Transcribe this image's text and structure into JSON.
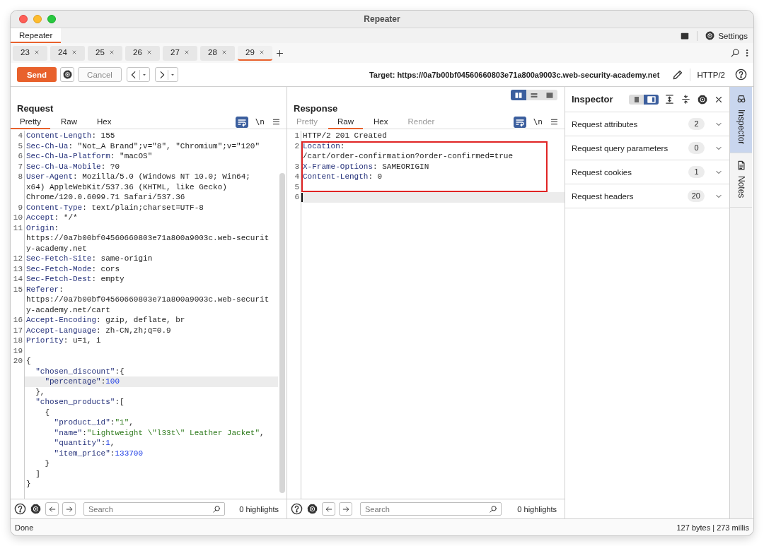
{
  "window": {
    "title": "Repeater"
  },
  "tool_tabs": [
    {
      "label": "Repeater",
      "selected": true
    }
  ],
  "settings_button": "Settings",
  "repeater_tabs": [
    {
      "label": "23",
      "selected": false
    },
    {
      "label": "24",
      "selected": false
    },
    {
      "label": "25",
      "selected": false
    },
    {
      "label": "26",
      "selected": false
    },
    {
      "label": "27",
      "selected": false
    },
    {
      "label": "28",
      "selected": false
    },
    {
      "label": "29",
      "selected": true
    }
  ],
  "toolbar": {
    "send": "Send",
    "cancel": "Cancel",
    "cancel_disabled": true,
    "target": "Target: https://0a7b00bf04560660803e71a800a9003c.web-security-academy.net",
    "protocol": "HTTP/2"
  },
  "request": {
    "title": "Request",
    "view_tabs": [
      {
        "label": "Pretty",
        "selected": true,
        "disabled": false
      },
      {
        "label": "Raw",
        "selected": false,
        "disabled": false
      },
      {
        "label": "Hex",
        "selected": false,
        "disabled": false
      }
    ],
    "wrap_on": true,
    "newline_toggle": "\\n",
    "lines": [
      {
        "number": "4",
        "parts": [
          {
            "kind": "key",
            "text": "Content-Length"
          },
          {
            "kind": "plain",
            "text": ": 155"
          }
        ],
        "highlighted": false
      },
      {
        "number": "5",
        "parts": [
          {
            "kind": "key",
            "text": "Sec-Ch-Ua"
          },
          {
            "kind": "plain",
            "text": ": \"Not_A Brand\";v=\"8\", \"Chromium\";v=\"120\""
          }
        ],
        "highlighted": false
      },
      {
        "number": "6",
        "parts": [
          {
            "kind": "key",
            "text": "Sec-Ch-Ua-Platform"
          },
          {
            "kind": "plain",
            "text": ": \"macOS\""
          }
        ],
        "highlighted": false
      },
      {
        "number": "7",
        "parts": [
          {
            "kind": "key",
            "text": "Sec-Ch-Ua-Mobile"
          },
          {
            "kind": "plain",
            "text": ": ?0"
          }
        ],
        "highlighted": false
      },
      {
        "number": "8",
        "parts": [
          {
            "kind": "key",
            "text": "User-Agent"
          },
          {
            "kind": "plain",
            "text": ": Mozilla/5.0 (Windows NT 10.0; Win64;"
          }
        ],
        "highlighted": false
      },
      {
        "parts": [
          {
            "kind": "plain",
            "text": "x64) AppleWebKit/537.36 (KHTML, like Gecko)"
          }
        ],
        "highlighted": false
      },
      {
        "parts": [
          {
            "kind": "plain",
            "text": "Chrome/120.0.6099.71 Safari/537.36"
          }
        ],
        "highlighted": false
      },
      {
        "number": "9",
        "parts": [
          {
            "kind": "key",
            "text": "Content-Type"
          },
          {
            "kind": "plain",
            "text": ": text/plain;charset=UTF-8"
          }
        ],
        "highlighted": false
      },
      {
        "number": "10",
        "parts": [
          {
            "kind": "key",
            "text": "Accept"
          },
          {
            "kind": "plain",
            "text": ": */*"
          }
        ],
        "highlighted": false
      },
      {
        "number": "11",
        "parts": [
          {
            "kind": "key",
            "text": "Origin"
          },
          {
            "kind": "plain",
            "text": ":"
          }
        ],
        "highlighted": false
      },
      {
        "parts": [
          {
            "kind": "plain",
            "text": "https://0a7b00bf04560660803e71a800a9003c.web-securit"
          }
        ],
        "highlighted": false
      },
      {
        "parts": [
          {
            "kind": "plain",
            "text": "y-academy.net"
          }
        ],
        "highlighted": false
      },
      {
        "number": "12",
        "parts": [
          {
            "kind": "key",
            "text": "Sec-Fetch-Site"
          },
          {
            "kind": "plain",
            "text": ": same-origin"
          }
        ],
        "highlighted": false
      },
      {
        "number": "13",
        "parts": [
          {
            "kind": "key",
            "text": "Sec-Fetch-Mode"
          },
          {
            "kind": "plain",
            "text": ": cors"
          }
        ],
        "highlighted": false
      },
      {
        "number": "14",
        "parts": [
          {
            "kind": "key",
            "text": "Sec-Fetch-Dest"
          },
          {
            "kind": "plain",
            "text": ": empty"
          }
        ],
        "highlighted": false
      },
      {
        "number": "15",
        "parts": [
          {
            "kind": "key",
            "text": "Referer"
          },
          {
            "kind": "plain",
            "text": ":"
          }
        ],
        "highlighted": false
      },
      {
        "parts": [
          {
            "kind": "plain",
            "text": "https://0a7b00bf04560660803e71a800a9003c.web-securit"
          }
        ],
        "highlighted": false
      },
      {
        "parts": [
          {
            "kind": "plain",
            "text": "y-academy.net/cart"
          }
        ],
        "highlighted": false
      },
      {
        "number": "16",
        "parts": [
          {
            "kind": "key",
            "text": "Accept-Encoding"
          },
          {
            "kind": "plain",
            "text": ": gzip, deflate, br"
          }
        ],
        "highlighted": false
      },
      {
        "number": "17",
        "parts": [
          {
            "kind": "key",
            "text": "Accept-Language"
          },
          {
            "kind": "plain",
            "text": ": zh-CN,zh;q=0.9"
          }
        ],
        "highlighted": false
      },
      {
        "number": "18",
        "parts": [
          {
            "kind": "key",
            "text": "Priority"
          },
          {
            "kind": "plain",
            "text": ": u=1, i"
          }
        ],
        "highlighted": false
      },
      {
        "number": "19",
        "highlighted": false
      },
      {
        "number": "20",
        "parts": [
          {
            "kind": "plain",
            "text": "{"
          }
        ],
        "highlighted": false
      },
      {
        "parts": [
          {
            "kind": "key",
            "text": "  \"chosen_discount\""
          },
          {
            "kind": "plain",
            "text": ":{"
          }
        ],
        "highlighted": false
      },
      {
        "parts": [
          {
            "kind": "key",
            "text": "    \"percentage\""
          },
          {
            "kind": "plain",
            "text": ":"
          },
          {
            "kind": "number",
            "text": "100"
          }
        ],
        "highlighted": true
      },
      {
        "parts": [
          {
            "kind": "plain",
            "text": "  },"
          }
        ],
        "highlighted": false
      },
      {
        "parts": [
          {
            "kind": "key",
            "text": "  \"chosen_products\""
          },
          {
            "kind": "plain",
            "text": ":["
          }
        ],
        "highlighted": false
      },
      {
        "parts": [
          {
            "kind": "plain",
            "text": "    {"
          }
        ],
        "highlighted": false
      },
      {
        "parts": [
          {
            "kind": "key",
            "text": "      \"product_id\""
          },
          {
            "kind": "plain",
            "text": ":"
          },
          {
            "kind": "string",
            "text": "\"1\""
          },
          {
            "kind": "plain",
            "text": ","
          }
        ],
        "highlighted": false
      },
      {
        "parts": [
          {
            "kind": "key",
            "text": "      \"name\""
          },
          {
            "kind": "plain",
            "text": ":"
          },
          {
            "kind": "string",
            "text": "\"Lightweight \\\"l33t\\\" Leather Jacket\""
          },
          {
            "kind": "plain",
            "text": ","
          }
        ],
        "highlighted": false
      },
      {
        "parts": [
          {
            "kind": "key",
            "text": "      \"quantity\""
          },
          {
            "kind": "plain",
            "text": ":"
          },
          {
            "kind": "number",
            "text": "1"
          },
          {
            "kind": "plain",
            "text": ","
          }
        ],
        "highlighted": false
      },
      {
        "parts": [
          {
            "kind": "key",
            "text": "      \"item_price\""
          },
          {
            "kind": "plain",
            "text": ":"
          },
          {
            "kind": "number",
            "text": "133700"
          }
        ],
        "highlighted": false
      },
      {
        "parts": [
          {
            "kind": "plain",
            "text": "    }"
          }
        ],
        "highlighted": false
      },
      {
        "parts": [
          {
            "kind": "plain",
            "text": "  ]"
          }
        ],
        "highlighted": false
      },
      {
        "parts": [
          {
            "kind": "plain",
            "text": "}"
          }
        ],
        "highlighted": false
      }
    ],
    "search": {
      "placeholder": "Search"
    },
    "highlights": "0 highlights"
  },
  "response": {
    "title": "Response",
    "layout_buttons": [
      {
        "kind": "columns",
        "selected": true
      },
      {
        "kind": "rows",
        "selected": false
      },
      {
        "kind": "single",
        "selected": false
      }
    ],
    "view_tabs": [
      {
        "label": "Pretty",
        "selected": false,
        "disabled": true
      },
      {
        "label": "Raw",
        "selected": true,
        "disabled": false
      },
      {
        "label": "Hex",
        "selected": false,
        "disabled": false
      },
      {
        "label": "Render",
        "selected": false,
        "disabled": true
      }
    ],
    "wrap_on": true,
    "newline_toggle": "\\n",
    "lines": [
      {
        "number": "1",
        "parts": [
          {
            "kind": "plain",
            "text": "HTTP/2 201 Created"
          }
        ],
        "highlighted": false
      },
      {
        "number": "2",
        "parts": [
          {
            "kind": "key",
            "text": "Location"
          },
          {
            "kind": "plain",
            "text": ":"
          }
        ],
        "highlighted": false,
        "boxed": true
      },
      {
        "parts": [
          {
            "kind": "plain",
            "text": "/cart/order-confirmation?order-confirmed=true"
          }
        ],
        "highlighted": false,
        "boxed": true
      },
      {
        "number": "3",
        "parts": [
          {
            "kind": "key",
            "text": "X-Frame-Options"
          },
          {
            "kind": "plain",
            "text": ": SAMEORIGIN"
          }
        ],
        "highlighted": false,
        "boxed": true
      },
      {
        "number": "4",
        "parts": [
          {
            "kind": "key",
            "text": "Content-Length"
          },
          {
            "kind": "plain",
            "text": ": 0"
          }
        ],
        "highlighted": false,
        "boxed": true
      },
      {
        "number": "5",
        "highlighted": false,
        "boxed": true
      },
      {
        "number": "6",
        "highlighted": true,
        "cursor": true
      }
    ],
    "search": {
      "placeholder": "Search"
    },
    "highlights": "0 highlights"
  },
  "inspector": {
    "title": "Inspector",
    "view_buttons": [
      {
        "selected": false
      },
      {
        "selected": true
      }
    ],
    "sections": [
      {
        "label": "Request attributes",
        "count": "2"
      },
      {
        "label": "Request query parameters",
        "count": "0"
      },
      {
        "label": "Request cookies",
        "count": "1"
      },
      {
        "label": "Request headers",
        "count": "20"
      }
    ]
  },
  "side_tabs": [
    {
      "label": "Inspector",
      "selected": true
    },
    {
      "label": "Notes",
      "selected": false
    }
  ],
  "status_bar": {
    "message": "Done",
    "stats": "127 bytes | 273 millis"
  }
}
